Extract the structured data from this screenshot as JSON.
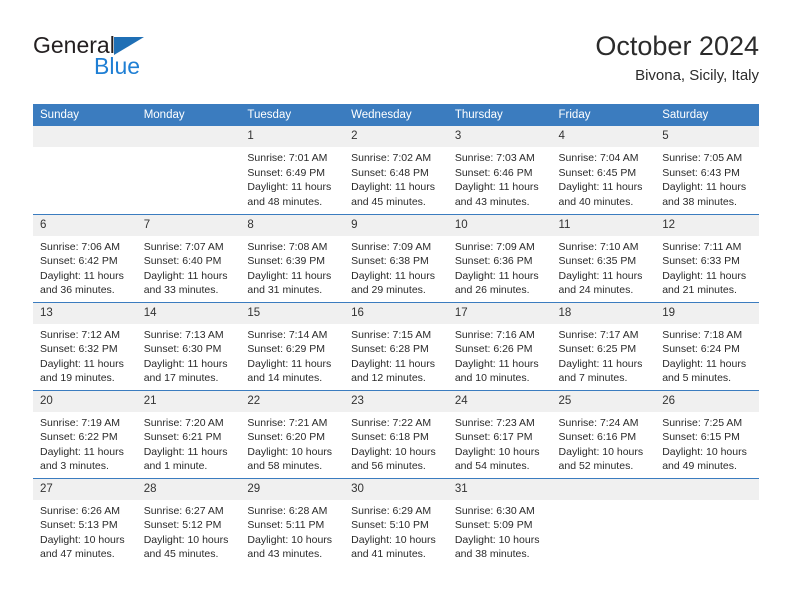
{
  "brand": {
    "name_part1": "General",
    "name_part2": "Blue",
    "triangle_color": "#1f6fb5",
    "blue_color": "#1f7fd4"
  },
  "header": {
    "title": "October 2024",
    "subtitle": "Bivona, Sicily, Italy",
    "header_bg": "#3b7cbf",
    "daynum_bg": "#f0f0f0"
  },
  "weekdays": [
    "Sunday",
    "Monday",
    "Tuesday",
    "Wednesday",
    "Thursday",
    "Friday",
    "Saturday"
  ],
  "weeks": [
    [
      {
        "day": "",
        "empty": true
      },
      {
        "day": "",
        "empty": true
      },
      {
        "day": "1",
        "sunrise": "Sunrise: 7:01 AM",
        "sunset": "Sunset: 6:49 PM",
        "daylight_line1": "Daylight: 11 hours",
        "daylight_line2": "and 48 minutes."
      },
      {
        "day": "2",
        "sunrise": "Sunrise: 7:02 AM",
        "sunset": "Sunset: 6:48 PM",
        "daylight_line1": "Daylight: 11 hours",
        "daylight_line2": "and 45 minutes."
      },
      {
        "day": "3",
        "sunrise": "Sunrise: 7:03 AM",
        "sunset": "Sunset: 6:46 PM",
        "daylight_line1": "Daylight: 11 hours",
        "daylight_line2": "and 43 minutes."
      },
      {
        "day": "4",
        "sunrise": "Sunrise: 7:04 AM",
        "sunset": "Sunset: 6:45 PM",
        "daylight_line1": "Daylight: 11 hours",
        "daylight_line2": "and 40 minutes."
      },
      {
        "day": "5",
        "sunrise": "Sunrise: 7:05 AM",
        "sunset": "Sunset: 6:43 PM",
        "daylight_line1": "Daylight: 11 hours",
        "daylight_line2": "and 38 minutes."
      }
    ],
    [
      {
        "day": "6",
        "sunrise": "Sunrise: 7:06 AM",
        "sunset": "Sunset: 6:42 PM",
        "daylight_line1": "Daylight: 11 hours",
        "daylight_line2": "and 36 minutes."
      },
      {
        "day": "7",
        "sunrise": "Sunrise: 7:07 AM",
        "sunset": "Sunset: 6:40 PM",
        "daylight_line1": "Daylight: 11 hours",
        "daylight_line2": "and 33 minutes."
      },
      {
        "day": "8",
        "sunrise": "Sunrise: 7:08 AM",
        "sunset": "Sunset: 6:39 PM",
        "daylight_line1": "Daylight: 11 hours",
        "daylight_line2": "and 31 minutes."
      },
      {
        "day": "9",
        "sunrise": "Sunrise: 7:09 AM",
        "sunset": "Sunset: 6:38 PM",
        "daylight_line1": "Daylight: 11 hours",
        "daylight_line2": "and 29 minutes."
      },
      {
        "day": "10",
        "sunrise": "Sunrise: 7:09 AM",
        "sunset": "Sunset: 6:36 PM",
        "daylight_line1": "Daylight: 11 hours",
        "daylight_line2": "and 26 minutes."
      },
      {
        "day": "11",
        "sunrise": "Sunrise: 7:10 AM",
        "sunset": "Sunset: 6:35 PM",
        "daylight_line1": "Daylight: 11 hours",
        "daylight_line2": "and 24 minutes."
      },
      {
        "day": "12",
        "sunrise": "Sunrise: 7:11 AM",
        "sunset": "Sunset: 6:33 PM",
        "daylight_line1": "Daylight: 11 hours",
        "daylight_line2": "and 21 minutes."
      }
    ],
    [
      {
        "day": "13",
        "sunrise": "Sunrise: 7:12 AM",
        "sunset": "Sunset: 6:32 PM",
        "daylight_line1": "Daylight: 11 hours",
        "daylight_line2": "and 19 minutes."
      },
      {
        "day": "14",
        "sunrise": "Sunrise: 7:13 AM",
        "sunset": "Sunset: 6:30 PM",
        "daylight_line1": "Daylight: 11 hours",
        "daylight_line2": "and 17 minutes."
      },
      {
        "day": "15",
        "sunrise": "Sunrise: 7:14 AM",
        "sunset": "Sunset: 6:29 PM",
        "daylight_line1": "Daylight: 11 hours",
        "daylight_line2": "and 14 minutes."
      },
      {
        "day": "16",
        "sunrise": "Sunrise: 7:15 AM",
        "sunset": "Sunset: 6:28 PM",
        "daylight_line1": "Daylight: 11 hours",
        "daylight_line2": "and 12 minutes."
      },
      {
        "day": "17",
        "sunrise": "Sunrise: 7:16 AM",
        "sunset": "Sunset: 6:26 PM",
        "daylight_line1": "Daylight: 11 hours",
        "daylight_line2": "and 10 minutes."
      },
      {
        "day": "18",
        "sunrise": "Sunrise: 7:17 AM",
        "sunset": "Sunset: 6:25 PM",
        "daylight_line1": "Daylight: 11 hours",
        "daylight_line2": "and 7 minutes."
      },
      {
        "day": "19",
        "sunrise": "Sunrise: 7:18 AM",
        "sunset": "Sunset: 6:24 PM",
        "daylight_line1": "Daylight: 11 hours",
        "daylight_line2": "and 5 minutes."
      }
    ],
    [
      {
        "day": "20",
        "sunrise": "Sunrise: 7:19 AM",
        "sunset": "Sunset: 6:22 PM",
        "daylight_line1": "Daylight: 11 hours",
        "daylight_line2": "and 3 minutes."
      },
      {
        "day": "21",
        "sunrise": "Sunrise: 7:20 AM",
        "sunset": "Sunset: 6:21 PM",
        "daylight_line1": "Daylight: 11 hours",
        "daylight_line2": "and 1 minute."
      },
      {
        "day": "22",
        "sunrise": "Sunrise: 7:21 AM",
        "sunset": "Sunset: 6:20 PM",
        "daylight_line1": "Daylight: 10 hours",
        "daylight_line2": "and 58 minutes."
      },
      {
        "day": "23",
        "sunrise": "Sunrise: 7:22 AM",
        "sunset": "Sunset: 6:18 PM",
        "daylight_line1": "Daylight: 10 hours",
        "daylight_line2": "and 56 minutes."
      },
      {
        "day": "24",
        "sunrise": "Sunrise: 7:23 AM",
        "sunset": "Sunset: 6:17 PM",
        "daylight_line1": "Daylight: 10 hours",
        "daylight_line2": "and 54 minutes."
      },
      {
        "day": "25",
        "sunrise": "Sunrise: 7:24 AM",
        "sunset": "Sunset: 6:16 PM",
        "daylight_line1": "Daylight: 10 hours",
        "daylight_line2": "and 52 minutes."
      },
      {
        "day": "26",
        "sunrise": "Sunrise: 7:25 AM",
        "sunset": "Sunset: 6:15 PM",
        "daylight_line1": "Daylight: 10 hours",
        "daylight_line2": "and 49 minutes."
      }
    ],
    [
      {
        "day": "27",
        "sunrise": "Sunrise: 6:26 AM",
        "sunset": "Sunset: 5:13 PM",
        "daylight_line1": "Daylight: 10 hours",
        "daylight_line2": "and 47 minutes."
      },
      {
        "day": "28",
        "sunrise": "Sunrise: 6:27 AM",
        "sunset": "Sunset: 5:12 PM",
        "daylight_line1": "Daylight: 10 hours",
        "daylight_line2": "and 45 minutes."
      },
      {
        "day": "29",
        "sunrise": "Sunrise: 6:28 AM",
        "sunset": "Sunset: 5:11 PM",
        "daylight_line1": "Daylight: 10 hours",
        "daylight_line2": "and 43 minutes."
      },
      {
        "day": "30",
        "sunrise": "Sunrise: 6:29 AM",
        "sunset": "Sunset: 5:10 PM",
        "daylight_line1": "Daylight: 10 hours",
        "daylight_line2": "and 41 minutes."
      },
      {
        "day": "31",
        "sunrise": "Sunrise: 6:30 AM",
        "sunset": "Sunset: 5:09 PM",
        "daylight_line1": "Daylight: 10 hours",
        "daylight_line2": "and 38 minutes."
      },
      {
        "day": "",
        "empty": true
      },
      {
        "day": "",
        "empty": true
      }
    ]
  ]
}
